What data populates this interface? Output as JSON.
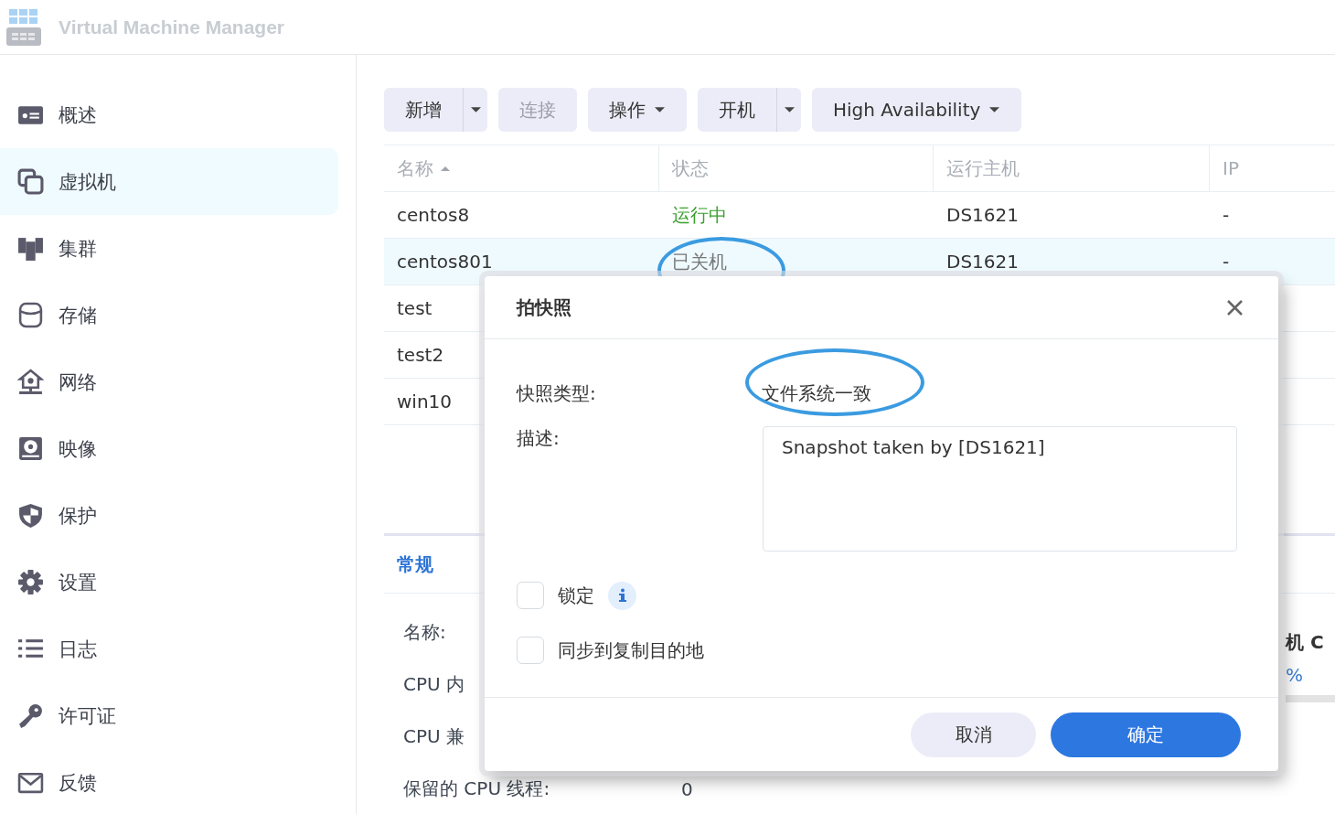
{
  "app": {
    "title": "Virtual Machine Manager"
  },
  "sidebar": {
    "items": [
      {
        "label": "概述",
        "kind": "overview",
        "selected": false
      },
      {
        "label": "虚拟机",
        "kind": "vm",
        "selected": true
      },
      {
        "label": "集群",
        "kind": "cluster",
        "selected": false
      },
      {
        "label": "存储",
        "kind": "storage",
        "selected": false
      },
      {
        "label": "网络",
        "kind": "network",
        "selected": false
      },
      {
        "label": "映像",
        "kind": "image",
        "selected": false
      },
      {
        "label": "保护",
        "kind": "protect",
        "selected": false
      },
      {
        "label": "设置",
        "kind": "settings",
        "selected": false
      },
      {
        "label": "日志",
        "kind": "log",
        "selected": false
      },
      {
        "label": "许可证",
        "kind": "license",
        "selected": false
      },
      {
        "label": "反馈",
        "kind": "feedback",
        "selected": false
      }
    ]
  },
  "toolbar": {
    "buttons": [
      {
        "label": "新增",
        "kind": "split",
        "disabled": false
      },
      {
        "label": "连接",
        "kind": "plain",
        "disabled": true
      },
      {
        "label": "操作",
        "kind": "menu",
        "disabled": false
      },
      {
        "label": "开机",
        "kind": "split",
        "disabled": false
      },
      {
        "label": "High Availability",
        "kind": "menu",
        "disabled": false
      }
    ]
  },
  "table": {
    "columns": [
      {
        "label": "名称",
        "sorted": true
      },
      {
        "label": "状态",
        "sorted": false
      },
      {
        "label": "运行主机",
        "sorted": false
      },
      {
        "label": "IP",
        "sorted": false
      }
    ],
    "rows": [
      {
        "cells": [
          "centos8",
          "运行中",
          "DS1621",
          "-"
        ],
        "color": "#3aa12e",
        "selected": false,
        "circled": false
      },
      {
        "cells": [
          "centos801",
          "已关机",
          "DS1621",
          "-"
        ],
        "color": "#777777",
        "selected": true,
        "circled": true
      },
      {
        "cells": [
          "test"
        ],
        "selected": false
      },
      {
        "cells": [
          "test2"
        ],
        "selected": false
      },
      {
        "cells": [
          "win10"
        ],
        "selected": false
      }
    ]
  },
  "details": {
    "tabs": [
      {
        "label": "常规",
        "selected": true
      }
    ],
    "fields": [
      {
        "label": "名称:"
      },
      {
        "label": "CPU 内"
      },
      {
        "label": "CPU 兼"
      },
      {
        "label": "保留的 CPU 线程:",
        "value": "0"
      }
    ],
    "side": {
      "heading": "机 C",
      "value": "%"
    }
  },
  "dialog": {
    "title": "拍快照",
    "type_label": "快照类型:",
    "type_value": "文件系统一致",
    "type_circled": true,
    "description_label": "描述:",
    "description": "Snapshot taken by [DS1621]",
    "options": [
      {
        "label": "锁定",
        "checked": false,
        "info": true
      },
      {
        "label": "同步到复制目的地",
        "checked": false,
        "info": false
      }
    ],
    "buttons": [
      {
        "label": "取消",
        "kind": "secondary"
      },
      {
        "label": "确定",
        "kind": "primary"
      }
    ]
  }
}
